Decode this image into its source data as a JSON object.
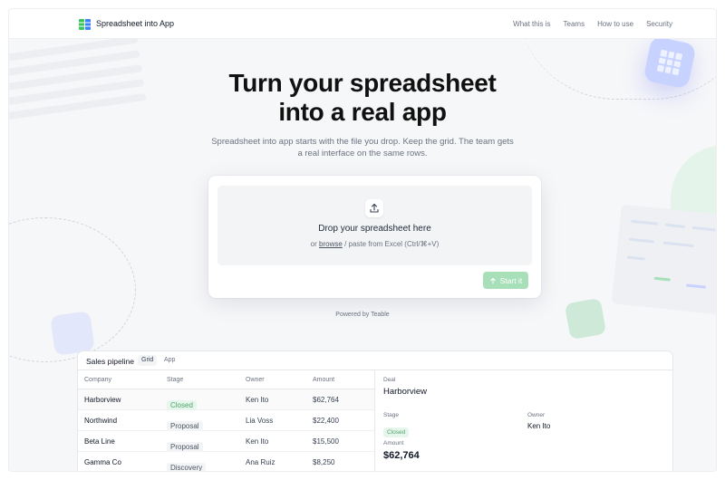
{
  "header": {
    "brand": "Spreadsheet into App",
    "nav": [
      "What this is",
      "Teams",
      "How to use",
      "Security"
    ]
  },
  "hero": {
    "title_line1": "Turn your spreadsheet",
    "title_line2": "into a real app",
    "subtitle": "Spreadsheet into app starts with the file you drop. Keep the grid. The team gets a real interface on the same rows."
  },
  "upload": {
    "icon": "upload-icon",
    "title": "Drop your spreadsheet here",
    "hint_prefix": "or",
    "hint_link": "browse",
    "hint_suffix": "/ paste from Excel (Ctrl/⌘+V)",
    "start_label": "Start it",
    "start_icon": "arrow-up-icon",
    "powered_by": "Powered by Teable"
  },
  "preview": {
    "title": "Sales pipeline",
    "tabs": [
      "Grid",
      "App"
    ],
    "columns": [
      "Company",
      "Stage",
      "Owner",
      "Amount"
    ],
    "rows": [
      {
        "company": "Harborview",
        "stage": "Closed",
        "owner": "Ken Ito",
        "amount": "$62,764"
      },
      {
        "company": "Northwind",
        "stage": "Proposal",
        "owner": "Lia Voss",
        "amount": "$22,400"
      },
      {
        "company": "Beta Line",
        "stage": "Proposal",
        "owner": "Ken Ito",
        "amount": "$15,500"
      },
      {
        "company": "Gamma Co",
        "stage": "Discovery",
        "owner": "Ana Ruiz",
        "amount": "$8,250"
      }
    ],
    "detail": {
      "deal_label": "Deal",
      "deal_value": "Harborview",
      "stage_label": "Stage",
      "stage_value": "Closed",
      "owner_label": "Owner",
      "owner_value": "Ken Ito",
      "amount_label": "Amount",
      "amount_value": "$62,764"
    }
  },
  "colors": {
    "accent_green": "#a7dfb9",
    "closed_badge_text": "#4ea56a",
    "brand_blue": "#3b82f6"
  }
}
